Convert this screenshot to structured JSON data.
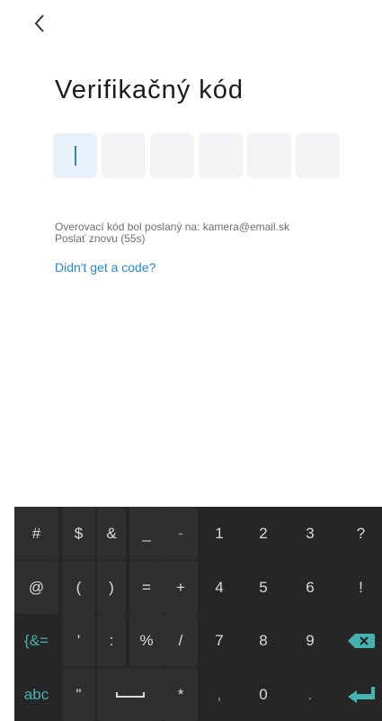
{
  "header": {
    "back_icon": "chevron-left-icon"
  },
  "title": "Verifikačný kód",
  "code": {
    "length": 6,
    "digits": [
      "",
      "",
      "",
      "",
      "",
      ""
    ],
    "active_index": 0
  },
  "info": {
    "sent_to": "Overovací kód bol poslaný na: kamera@email.sk",
    "resend": "Poslať znovu (55s)"
  },
  "help_link": "Didn't get a code?",
  "colors": {
    "accent": "#2a86c7",
    "keyboard_bg": "#262626",
    "keyboard_accent": "#47b2b2"
  },
  "keyboard": {
    "row1": [
      "#",
      "$",
      "&",
      "_",
      "-",
      "1",
      "2",
      "3",
      "?"
    ],
    "row2": [
      "@",
      "(",
      ")",
      "=",
      "+",
      "4",
      "5",
      "6",
      "!"
    ],
    "row3": [
      "{&=",
      "'",
      ":",
      "%",
      "/",
      "7",
      "8",
      "9",
      "backspace-icon"
    ],
    "row4": [
      "abc",
      "\"",
      "space-icon",
      "*",
      ",",
      "0",
      ".",
      "enter-icon"
    ]
  }
}
